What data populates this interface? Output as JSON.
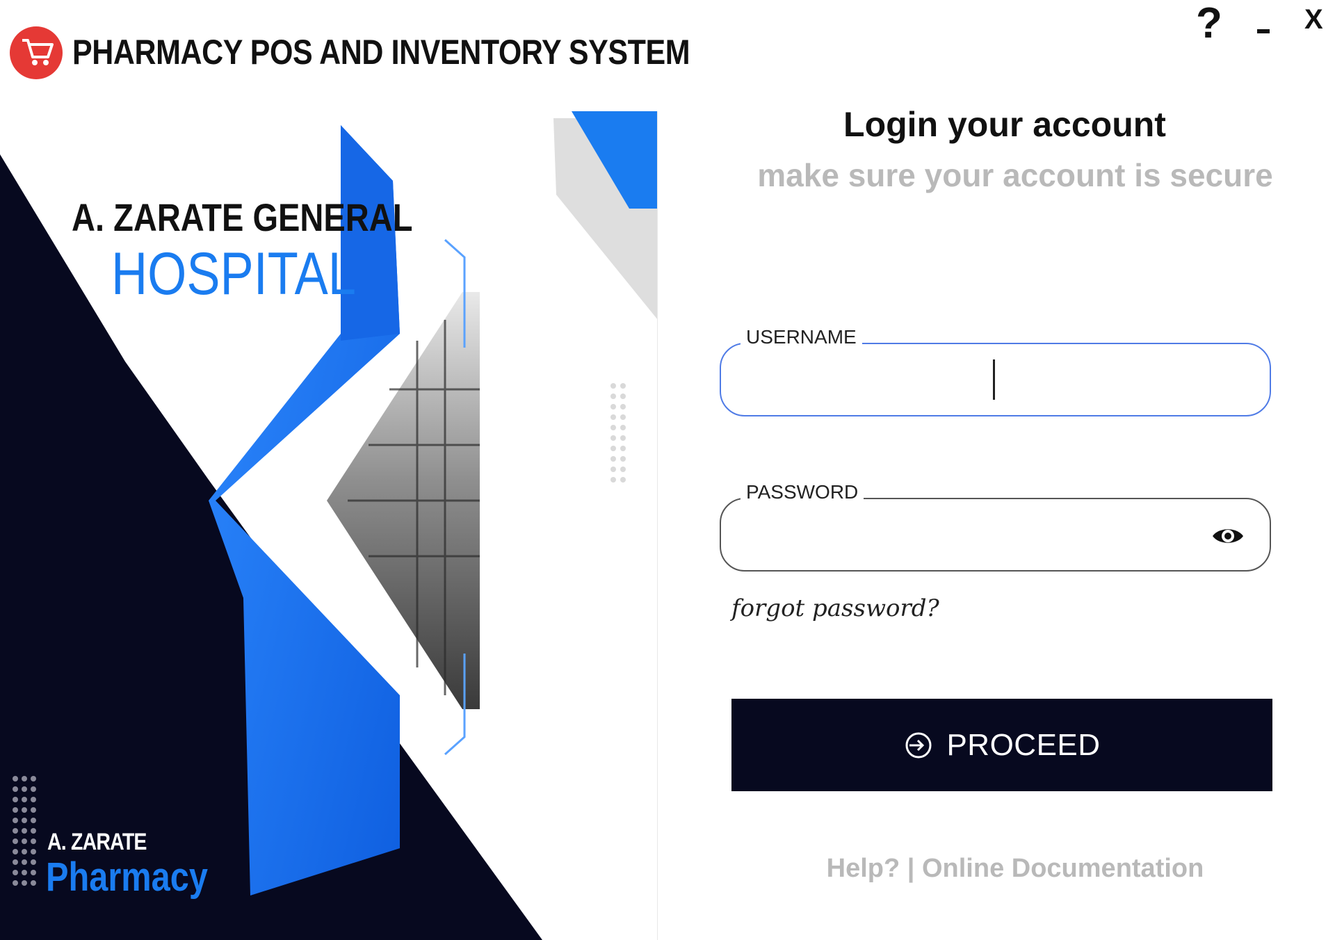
{
  "window": {
    "title": "PHARMACY POS AND INVENTORY SYSTEM",
    "help_symbol": "?",
    "close_symbol": "X"
  },
  "branding": {
    "hospital_line1": "A. ZARATE GENERAL",
    "hospital_line2": "HOSPITAL",
    "pharmacy_line1": "A. ZARATE",
    "pharmacy_line2": "Pharmacy"
  },
  "login": {
    "heading": "Login your account",
    "subheading": "make sure your account is secure",
    "username_label": "USERNAME",
    "username_value": "",
    "password_label": "PASSWORD",
    "password_value": "",
    "forgot_label": "forgot password?",
    "proceed_label": "PROCEED"
  },
  "footer": {
    "help_label": "Help?",
    "separator": "|",
    "docs_label": "Online Documentation"
  },
  "colors": {
    "brand_blue": "#1a7cf0",
    "navy": "#07091f",
    "logo_red": "#e53935",
    "muted_gray": "#b9b9b9",
    "focus_border": "#4f7be6"
  },
  "icons": {
    "app_logo": "shopping-cart-icon",
    "password_toggle": "eye-icon",
    "proceed": "login-arrow-icon"
  }
}
